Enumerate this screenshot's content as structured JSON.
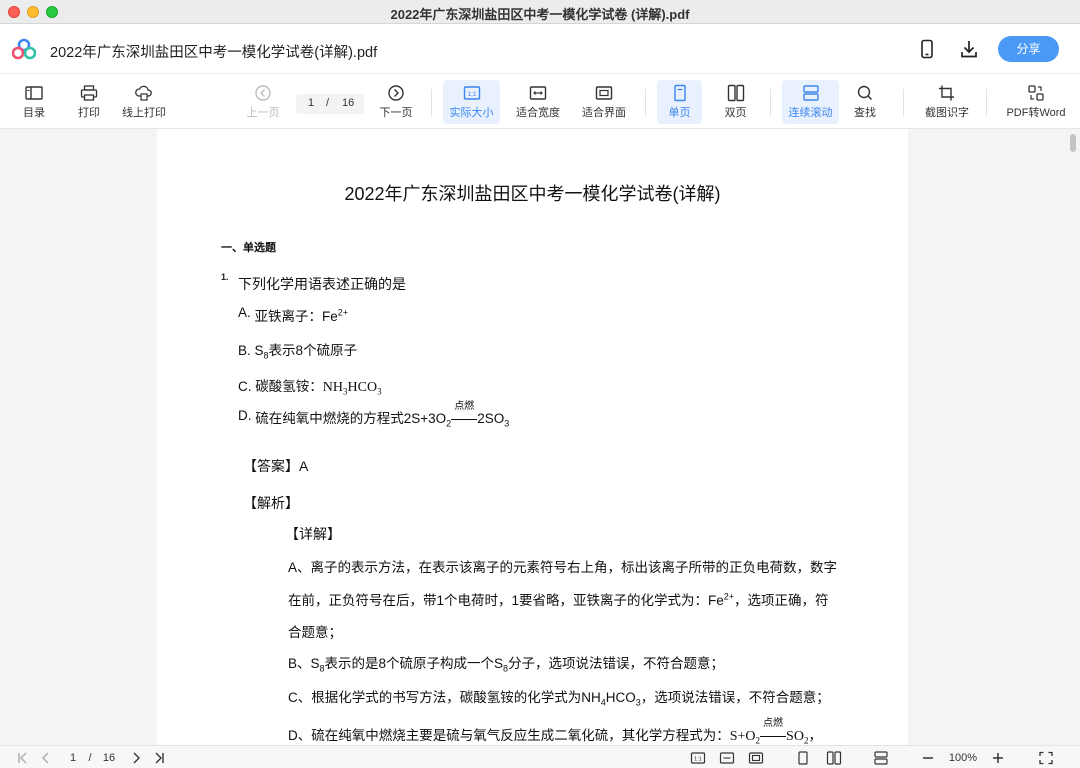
{
  "window": {
    "title": "2022年广东深圳盐田区中考一模化学试卷 (详解).pdf"
  },
  "header": {
    "doc_title": "2022年广东深圳盐田区中考一模化学试卷(详解).pdf",
    "share_label": "分享",
    "icons": [
      "phone-icon",
      "download-icon"
    ]
  },
  "toolbar": {
    "toc": "目录",
    "print": "打印",
    "online_print": "线上打印",
    "prev_page": "上一页",
    "current_page": "1",
    "separator": "/",
    "total_pages": "16",
    "next_page": "下一页",
    "actual_size": "实际大小",
    "fit_width": "适合宽度",
    "fit_page": "适合界面",
    "single_page": "单页",
    "double_page": "双页",
    "continuous_scroll": "连续滚动",
    "find": "查找",
    "screenshot_ocr": "截图识字",
    "pdf_to_word": "PDF转Word",
    "accent_color": "#3b86f0"
  },
  "document": {
    "title": "2022年广东深圳盐田区中考一模化学试卷(详解)",
    "section": "一、单选题",
    "question_number": "1.",
    "question": "下列化学用语表述正确的是",
    "options": {
      "a_label": "A.",
      "a_text": "亚铁离子：Fe",
      "a_sup": "2+",
      "b_label": "B.",
      "b_pre": "S",
      "b_sub": "8",
      "b_text": "表示8个硫原子",
      "c_label": "C.",
      "c_text": "碳酸氢铵：",
      "c_f1": "NH",
      "c_f1_sub": "3",
      "c_f2": "HCO",
      "c_f2_sub": "3",
      "d_label": "D.",
      "d_text": "硫在纯氧中燃烧的方程式2S+3O",
      "d_sub1": "2",
      "d_cond": "点燃",
      "d_prod": "2SO",
      "d_sub2": "3"
    },
    "answer_label": "【答案】",
    "answer": "A",
    "analysis_label": "【解析】",
    "detail_label": "【详解】",
    "lines": {
      "l1": "A、离子的表示方法，在表示该离子的元素符号右上角，标出该离子所带的正负电荷数，数字",
      "l2a": "在前，正负符号在后，带1个电荷时，1要省略，亚铁离子的化学式为：Fe",
      "l2sup": "2+",
      "l2b": "，选项正确，符",
      "l3": "合题意；",
      "l4a": "B、S",
      "l4sub1": "8",
      "l4b": "表示的是8个硫原子构成一个S",
      "l4sub2": "8",
      "l4c": "分子，选项说法错误，不符合题意；",
      "l5a": "C、根据化学式的书写方法，碳酸氢铵的化学式为NH",
      "l5sub1": "4",
      "l5b": "HCO",
      "l5sub2": "3",
      "l5c": "，选项说法错误，不符合题意；",
      "l6a": "D、硫在纯氧中燃烧主要是硫与氧气反应生成二氧化硫，其化学方程式为：",
      "l6f1": "S+O",
      "l6sub1": "2",
      "l6cond": "点燃",
      "l6f2": "SO",
      "l6sub2": "2",
      "l6c": "，"
    }
  },
  "statusbar": {
    "current_page": "1",
    "separator": "/",
    "total_pages": "16",
    "zoom": "100%"
  }
}
